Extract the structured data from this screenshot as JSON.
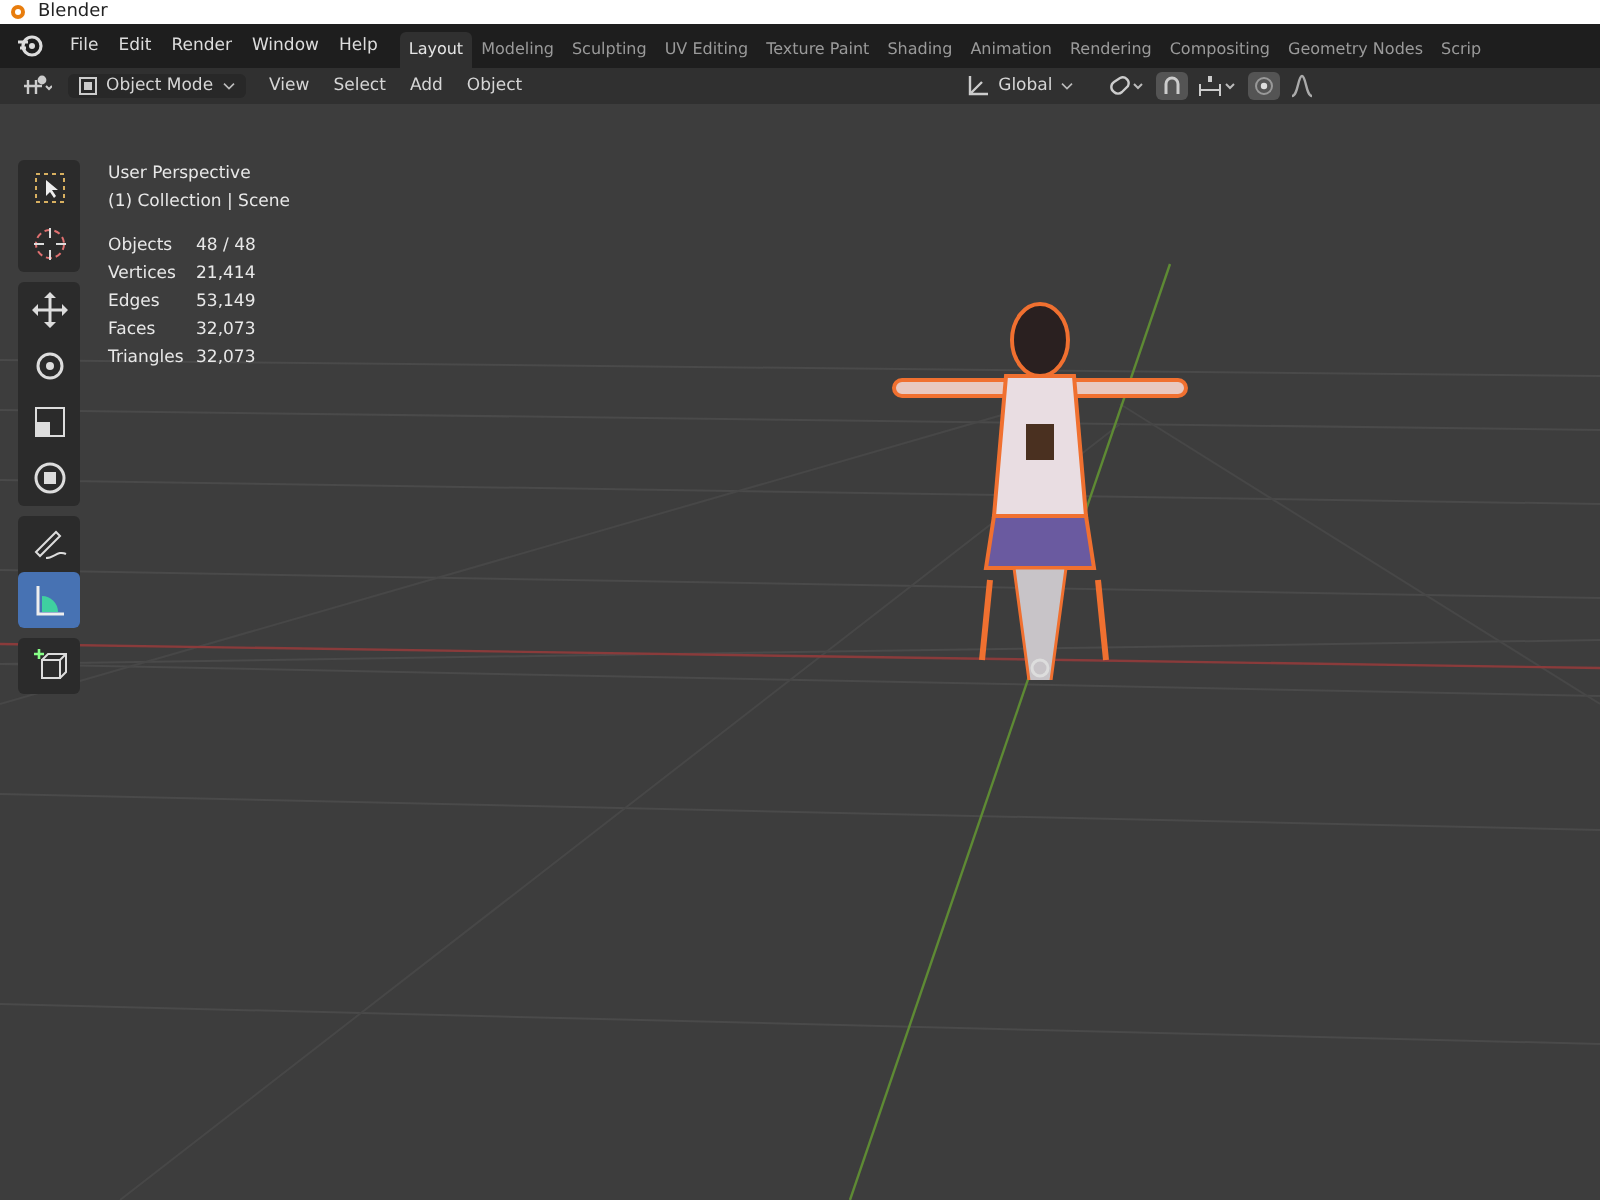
{
  "window": {
    "title": "Blender"
  },
  "menu": [
    "File",
    "Edit",
    "Render",
    "Window",
    "Help"
  ],
  "workspaces": [
    {
      "label": "Layout",
      "selected": true
    },
    {
      "label": "Modeling",
      "selected": false
    },
    {
      "label": "Sculpting",
      "selected": false
    },
    {
      "label": "UV Editing",
      "selected": false
    },
    {
      "label": "Texture Paint",
      "selected": false
    },
    {
      "label": "Shading",
      "selected": false
    },
    {
      "label": "Animation",
      "selected": false
    },
    {
      "label": "Rendering",
      "selected": false
    },
    {
      "label": "Compositing",
      "selected": false
    },
    {
      "label": "Geometry Nodes",
      "selected": false
    },
    {
      "label": "Scrip",
      "selected": false
    }
  ],
  "header": {
    "mode": "Object Mode",
    "menus": [
      "View",
      "Select",
      "Add",
      "Object"
    ],
    "orientation": "Global",
    "snap": {
      "on": true
    },
    "proportional_editing": {
      "on": true
    }
  },
  "toolbar": [
    {
      "kind": "select",
      "selected": false
    },
    {
      "kind": "cursor",
      "selected": false
    },
    {
      "kind": "move",
      "selected": false
    },
    {
      "kind": "rotate",
      "selected": false
    },
    {
      "kind": "scale",
      "selected": false
    },
    {
      "kind": "transform",
      "selected": false
    },
    {
      "kind": "annotate",
      "selected": false
    },
    {
      "kind": "measure",
      "selected": true
    },
    {
      "kind": "add_cube",
      "selected": false
    }
  ],
  "viewport": {
    "view": "User Perspective",
    "collection": "(1) Collection | Scene",
    "stats": [
      {
        "label": "Objects",
        "value": "48 / 48"
      },
      {
        "label": "Vertices",
        "value": "21,414"
      },
      {
        "label": "Edges",
        "value": "53,149"
      },
      {
        "label": "Faces",
        "value": "32,073"
      },
      {
        "label": "Triangles",
        "value": "32,073"
      }
    ]
  }
}
